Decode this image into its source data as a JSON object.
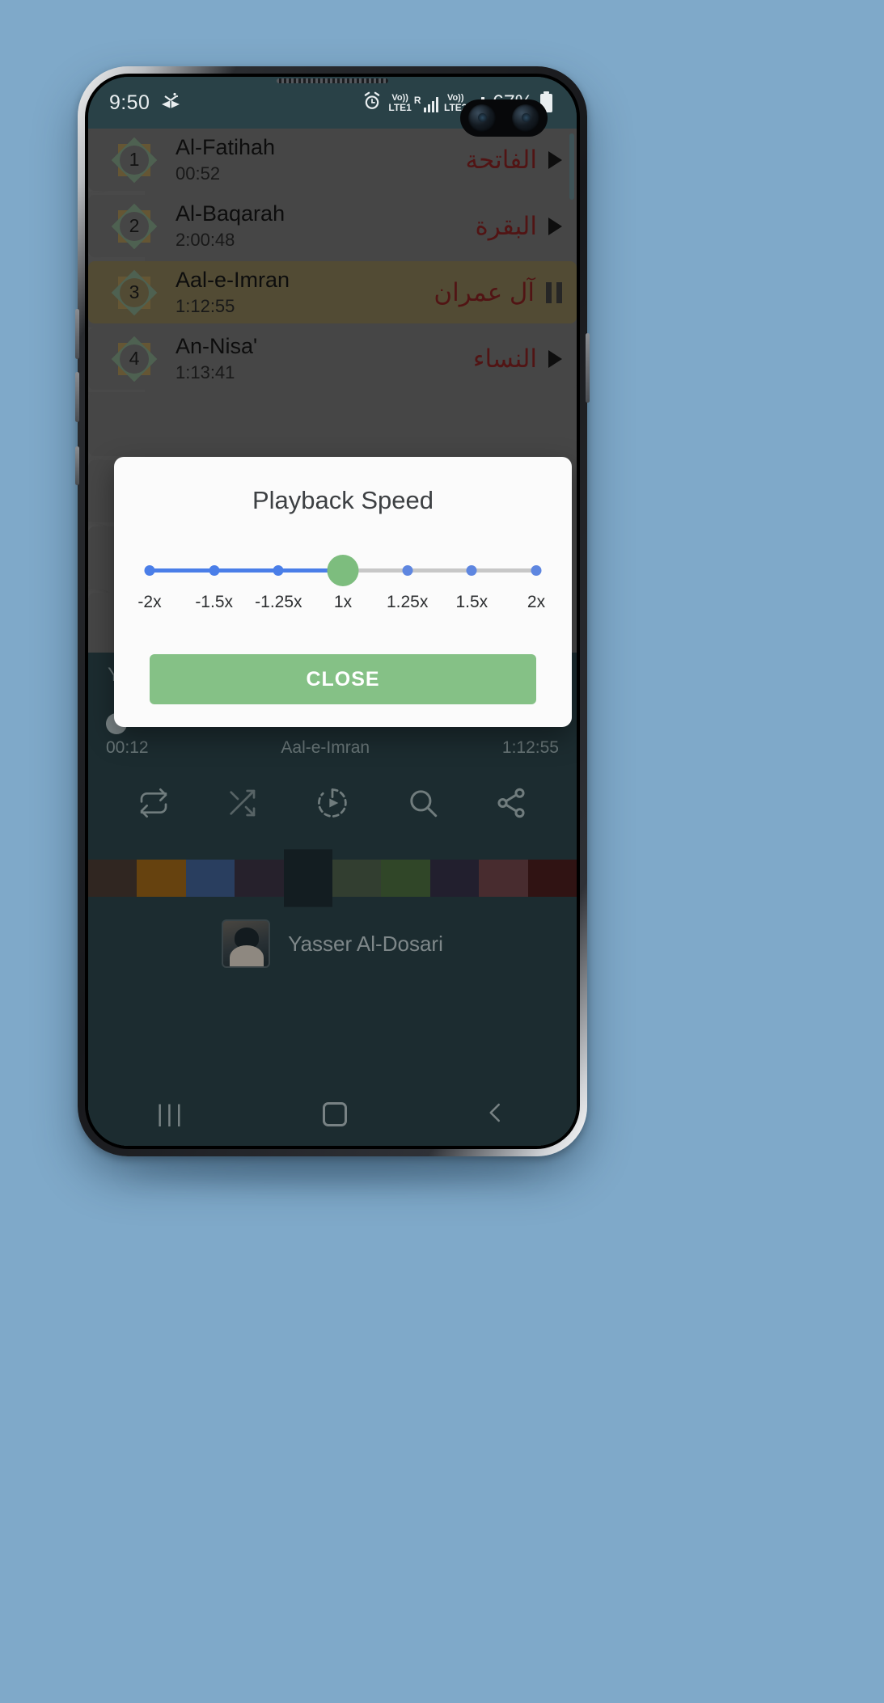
{
  "status_bar": {
    "clock": "9:50",
    "app_icon": "quran-icon",
    "alarm_icon": "alarm-clock-icon",
    "sim1": {
      "volte": "Vo))",
      "network": "LTE1",
      "roaming": "R"
    },
    "sim2": {
      "volte": "Vo))",
      "network": "LTE2"
    },
    "battery_percent": "67%"
  },
  "surah_list": {
    "rows": [
      {
        "number": "1",
        "name": "Al-Fatihah",
        "duration": "00:52",
        "arabic": "الفاتحة",
        "state": "paused",
        "action_icon": "play-icon"
      },
      {
        "number": "2",
        "name": "Al-Baqarah",
        "duration": "2:00:48",
        "arabic": "البقرة",
        "state": "paused",
        "action_icon": "play-icon"
      },
      {
        "number": "3",
        "name": "Aal-e-Imran",
        "duration": "1:12:55",
        "arabic": "آل عمران",
        "state": "playing",
        "action_icon": "pause-icon"
      },
      {
        "number": "4",
        "name": "An-Nisa'",
        "duration": "1:13:41",
        "arabic": "النساء",
        "state": "paused",
        "action_icon": "play-icon"
      }
    ]
  },
  "player": {
    "reciter_label": "Yasser Al-Dosari",
    "elapsed": "00:12",
    "now_playing": "Aal-e-Imran",
    "total": "1:12:55",
    "previous_icon": "skip-previous-icon",
    "play_pause_icon": "pause-icon",
    "next_icon": "skip-next-icon",
    "big_play_icon": "play-circle-icon",
    "functions": [
      {
        "icon": "repeat-icon",
        "name": "repeat-button"
      },
      {
        "icon": "shuffle-icon",
        "name": "shuffle-button"
      },
      {
        "icon": "sleep-timer-icon",
        "name": "playback-speed-button"
      },
      {
        "icon": "search-icon",
        "name": "search-button"
      },
      {
        "icon": "share-icon",
        "name": "share-button"
      }
    ],
    "theme_colors": [
      "#4a3a33",
      "#9c6418",
      "#3f5e91",
      "#3a3343",
      "#1e2c33",
      "#4c5f4a",
      "#4a6b3e",
      "#343047",
      "#6e4348",
      "#4a1d1d"
    ],
    "selected_theme_index": 4,
    "reciter_name": "Yasser Al-Dosari"
  },
  "dialog": {
    "title": "Playback Speed",
    "close_label": "CLOSE",
    "selected_value": "1x",
    "ticks": [
      {
        "label": "-2x",
        "active": true
      },
      {
        "label": "-1.5x",
        "active": true
      },
      {
        "label": "-1.25x",
        "active": true
      },
      {
        "label": "1x",
        "active": true
      },
      {
        "label": "1.25x",
        "active": false
      },
      {
        "label": "1.5x",
        "active": false
      },
      {
        "label": "2x",
        "active": false
      }
    ],
    "accent_track": "#4a7ee8",
    "accent_thumb": "#7dbd7e",
    "button_color": "#85c186"
  },
  "navigation_bar": {
    "recents_icon": "recents-icon",
    "home_icon": "home-icon",
    "back_icon": "back-icon"
  }
}
